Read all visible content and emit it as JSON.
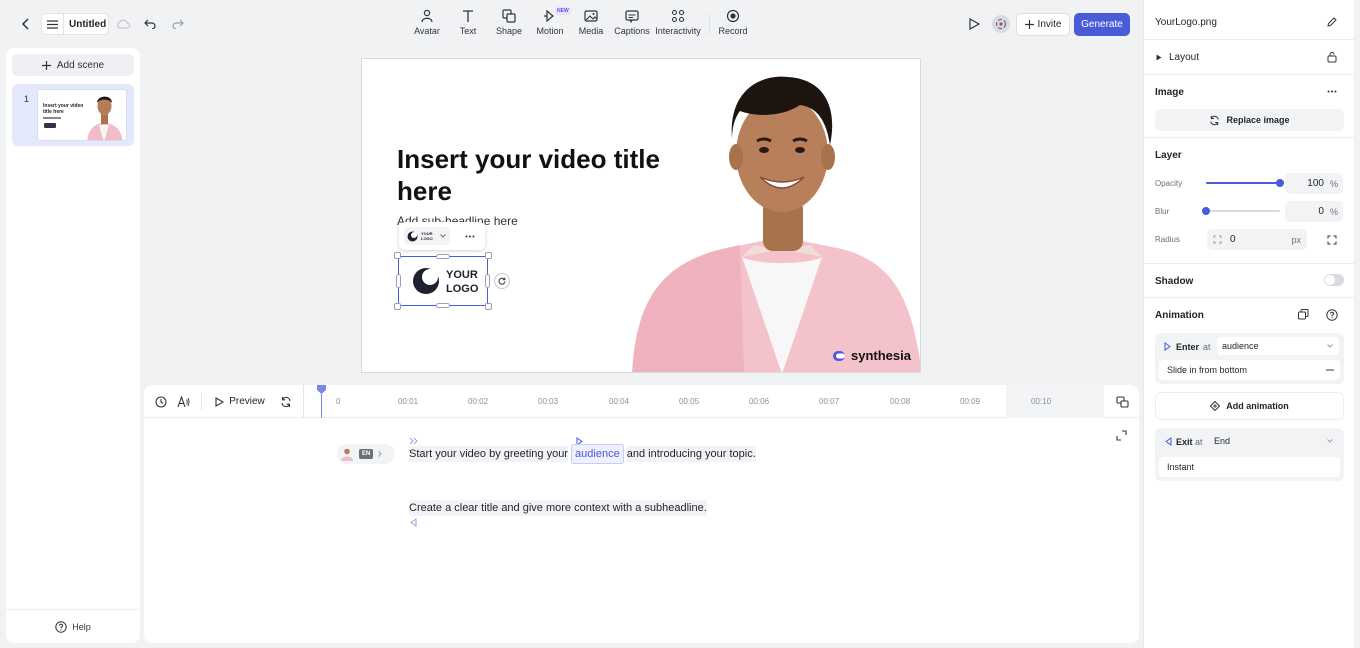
{
  "topbar": {
    "doc_title": "Untitled",
    "tools": [
      {
        "label": "Avatar",
        "icon": "avatar-icon"
      },
      {
        "label": "Text",
        "icon": "text-icon"
      },
      {
        "label": "Shape",
        "icon": "shape-icon"
      },
      {
        "label": "Motion",
        "icon": "motion-icon",
        "badge": "NEW"
      },
      {
        "label": "Media",
        "icon": "media-icon"
      },
      {
        "label": "Captions",
        "icon": "captions-icon"
      },
      {
        "label": "Interactivity",
        "icon": "interactivity-icon"
      },
      {
        "label": "Record",
        "icon": "record-icon"
      }
    ],
    "invite_label": "Invite",
    "generate_label": "Generate"
  },
  "left": {
    "add_scene_label": "Add scene",
    "scene_number": "1",
    "help_label": "Help"
  },
  "canvas": {
    "title": "Insert your video title here",
    "subheadline": "Add sub-headline here",
    "logo_line1": "YOUR",
    "logo_line2": "LOGO",
    "brand": "synthesia"
  },
  "timeline": {
    "preview_label": "Preview",
    "ticks": [
      "0",
      "00:01",
      "00:02",
      "00:03",
      "00:04",
      "00:05",
      "00:06",
      "00:07",
      "00:08",
      "00:09",
      "00:10"
    ],
    "lang_badge": "EN",
    "script1_before": "Start your video by greeting your",
    "script1_keyword": "audience",
    "script1_after": "and introducing your topic.",
    "script2": "Create a clear title and give more context with a subheadline."
  },
  "right": {
    "file_name": "YourLogo.png",
    "layout_label": "Layout",
    "image_label": "Image",
    "replace_label": "Replace image",
    "layer_label": "Layer",
    "opacity_label": "Opacity",
    "opacity_value": "100",
    "opacity_unit": "%",
    "opacity_level": 1.0,
    "blur_label": "Blur",
    "blur_value": "0",
    "blur_unit": "%",
    "radius_label": "Radius",
    "radius_value": "0",
    "radius_unit": "px",
    "shadow_label": "Shadow",
    "animation_label": "Animation",
    "enter_label": "Enter",
    "at_label": "at",
    "enter_at": "audience",
    "enter_effect": "Slide in from bottom",
    "add_animation_label": "Add animation",
    "exit_label": "Exit",
    "exit_at": "End",
    "exit_effect": "Instant"
  },
  "colors": {
    "accent": "#4a5bd8",
    "generate_bg": "#4a5bd8",
    "scene_selected": "#e4e8fb"
  }
}
